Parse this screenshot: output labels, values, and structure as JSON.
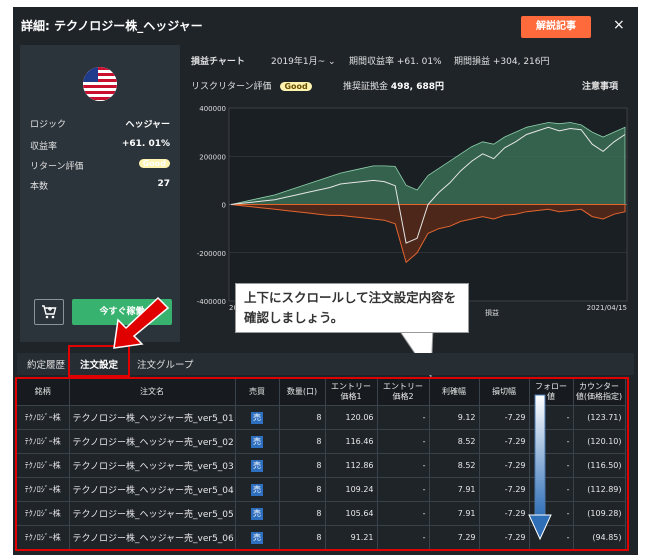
{
  "header": {
    "title": "詳細: テクノロジー株_ヘッジャー",
    "explain_label": "解説記事",
    "close": "×"
  },
  "left_panel": {
    "rows": [
      {
        "label": "ロジック",
        "value": "ヘッジャー"
      },
      {
        "label": "収益率",
        "value": "+61. 01%"
      },
      {
        "label": "リターン評価",
        "value": "Good"
      },
      {
        "label": "本数",
        "value": "27"
      }
    ],
    "buy_label": "今すぐ稼働"
  },
  "chart_header": {
    "title": "損益チャート",
    "period": "2019年1月~",
    "return_label": "期間収益率",
    "return_value": "+61. 01%",
    "pnl_label": "期間損益",
    "pnl_value": "+304, 216円",
    "risk_label": "リスクリターン評価",
    "risk_badge": "Good",
    "margin_label": "推奨証拠金",
    "margin_value": "498, 688円",
    "notice_label": "注意事項"
  },
  "callout": {
    "line1": "上下にスクロールして注文設定内容を",
    "line2": "確認しましょう。"
  },
  "tabs": [
    {
      "label": "約定履歴"
    },
    {
      "label": "注文設定"
    },
    {
      "label": "注文グループ"
    }
  ],
  "orders": {
    "headers": [
      "銘柄",
      "注文名",
      "売買",
      "数量(口)",
      "エントリー価格1",
      "エントリー価格2",
      "利確幅",
      "損切幅",
      "フォロー値",
      "カウンター値(価格指定)"
    ],
    "rows": [
      [
        "ﾃｸﾉﾛｼﾞｰ株",
        "テクノロジー株_ヘッジャー売_ver5_01",
        "売",
        "8",
        "120.06",
        "-",
        "9.12",
        "-7.29",
        "-",
        "(123.71)"
      ],
      [
        "ﾃｸﾉﾛｼﾞｰ株",
        "テクノロジー株_ヘッジャー売_ver5_02",
        "売",
        "8",
        "116.46",
        "-",
        "8.52",
        "-7.29",
        "-",
        "(120.10)"
      ],
      [
        "ﾃｸﾉﾛｼﾞｰ株",
        "テクノロジー株_ヘッジャー売_ver5_03",
        "売",
        "8",
        "112.86",
        "-",
        "8.52",
        "-7.29",
        "-",
        "(116.50)"
      ],
      [
        "ﾃｸﾉﾛｼﾞｰ株",
        "テクノロジー株_ヘッジャー売_ver5_04",
        "売",
        "8",
        "109.24",
        "-",
        "7.91",
        "-7.29",
        "-",
        "(112.89)"
      ],
      [
        "ﾃｸﾉﾛｼﾞｰ株",
        "テクノロジー株_ヘッジャー売_ver5_05",
        "売",
        "8",
        "105.64",
        "-",
        "7.91",
        "-7.29",
        "-",
        "(109.28)"
      ],
      [
        "ﾃｸﾉﾛｼﾞｰ株",
        "テクノロジー株_ヘッジャー売_ver5_06",
        "売",
        "8",
        "91.21",
        "-",
        "7.29",
        "-7.29",
        "-",
        "(94.85)"
      ]
    ]
  },
  "chart_data": {
    "type": "area",
    "yticks": [
      "400000",
      "200000",
      "0",
      "-200000",
      "-400000"
    ],
    "ylim": [
      -400000,
      400000
    ],
    "xlabel_end": "2021/04/15",
    "xlabel_start_partial": "201",
    "legend_partial": "損益",
    "series": [
      {
        "name": "",
        "color": "#8fd0ad",
        "values": [
          0,
          10000,
          20000,
          30000,
          40000,
          55000,
          70000,
          85000,
          100000,
          115000,
          130000,
          140000,
          150000,
          160000,
          160000,
          158000,
          80000,
          60000,
          120000,
          150000,
          180000,
          210000,
          240000,
          260000,
          250000,
          280000,
          300000,
          320000,
          330000,
          340000,
          335000,
          340000,
          330000,
          300000,
          280000,
          300000,
          320000
        ]
      },
      {
        "name": "",
        "color": "#e2642e",
        "values": [
          0,
          -5000,
          -10000,
          -15000,
          -20000,
          -25000,
          -30000,
          -35000,
          -40000,
          -45000,
          -45000,
          -50000,
          -55000,
          -60000,
          -65000,
          -80000,
          -240000,
          -200000,
          -120000,
          -100000,
          -90000,
          -70000,
          -60000,
          -50000,
          -60000,
          -45000,
          -40000,
          -30000,
          -25000,
          -20000,
          -30000,
          -25000,
          -20000,
          -50000,
          -60000,
          -40000,
          -30000
        ]
      },
      {
        "name": "",
        "color": "#e6e6e6",
        "values": [
          0,
          5000,
          10000,
          15000,
          20000,
          30000,
          40000,
          50000,
          60000,
          70000,
          85000,
          90000,
          95000,
          100000,
          95000,
          78000,
          -160000,
          -140000,
          0,
          50000,
          90000,
          140000,
          180000,
          210000,
          190000,
          235000,
          260000,
          290000,
          305000,
          320000,
          305000,
          315000,
          310000,
          250000,
          220000,
          260000,
          290000
        ]
      }
    ]
  },
  "colors": {
    "accent": "#ff6a3d",
    "buy": "#38b36f",
    "highlight": "#e00000",
    "sell": "#2f6fc0"
  }
}
